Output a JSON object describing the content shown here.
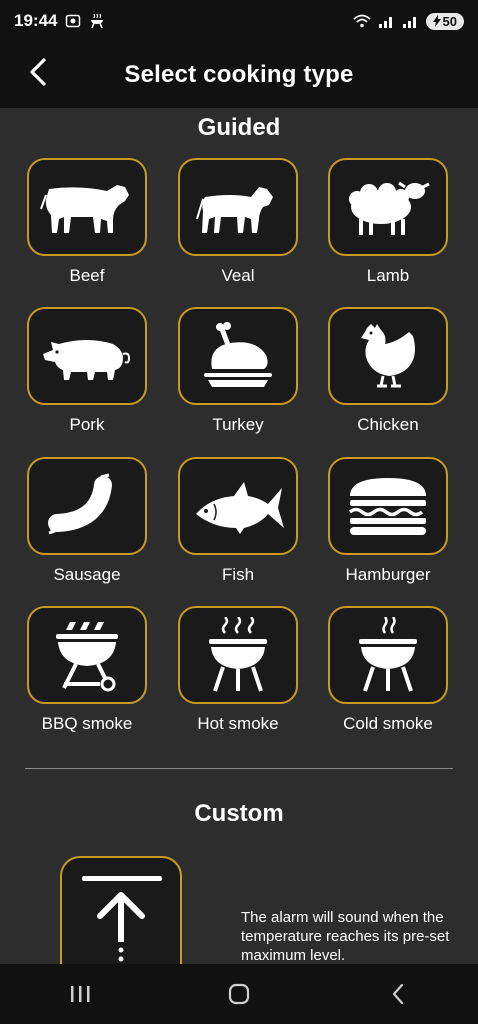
{
  "status_bar": {
    "time": "19:44",
    "battery": "50"
  },
  "header": {
    "title": "Select cooking type"
  },
  "guided": {
    "title": "Guided",
    "items": [
      {
        "label": "Beef",
        "icon": "cow-icon"
      },
      {
        "label": "Veal",
        "icon": "calf-icon"
      },
      {
        "label": "Lamb",
        "icon": "sheep-icon"
      },
      {
        "label": "Pork",
        "icon": "pig-icon"
      },
      {
        "label": "Turkey",
        "icon": "roast-turkey-icon"
      },
      {
        "label": "Chicken",
        "icon": "chicken-icon"
      },
      {
        "label": "Sausage",
        "icon": "sausage-icon"
      },
      {
        "label": "Fish",
        "icon": "fish-icon"
      },
      {
        "label": "Hamburger",
        "icon": "hamburger-icon"
      },
      {
        "label": "BBQ smoke",
        "icon": "bbq-smoke-icon"
      },
      {
        "label": "Hot smoke",
        "icon": "hot-smoke-icon"
      },
      {
        "label": "Cold smoke",
        "icon": "cold-smoke-icon"
      }
    ]
  },
  "custom": {
    "title": "Custom",
    "icon": "max-temperature-arrow-icon",
    "description": "The alarm will sound when the temperature reaches its pre-set maximum level."
  },
  "colors": {
    "accent": "#c99a22",
    "background": "#2d2d2d",
    "bar": "#111111",
    "tile": "#1a1a1a"
  }
}
